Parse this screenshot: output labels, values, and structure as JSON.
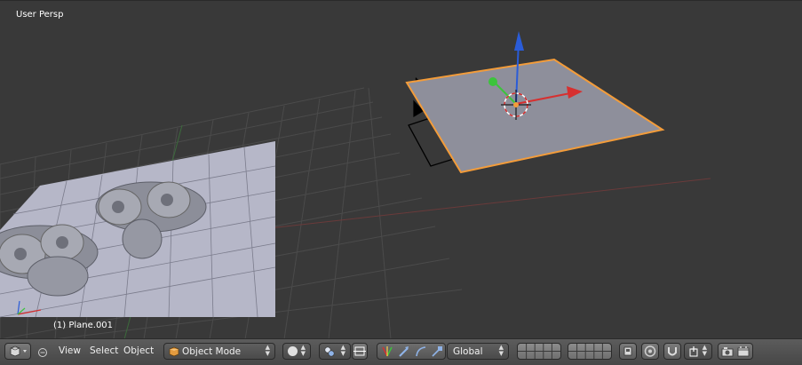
{
  "viewport": {
    "view_label": "User Persp",
    "object_label": "(1) Plane.001"
  },
  "header": {
    "menus": {
      "view": "View",
      "select": "Select",
      "object": "Object"
    },
    "mode": {
      "label": "Object Mode",
      "icon": "cube-icon"
    },
    "orientation": {
      "label": "Global"
    },
    "icons": [
      "view3d-editor-icon",
      "collapse-icon",
      "viewport-shading-icon",
      "pivot-point-icon",
      "snap-icon",
      "manipulator-icons",
      "layer-buttons",
      "lock-icon",
      "proportional-edit-icon",
      "magnet-icon",
      "render-icons"
    ]
  },
  "colors": {
    "viewport_bg": "#393939",
    "grid": "#4a4a4a",
    "selection_outline": "#f39c3a",
    "x_axis": "#d63030",
    "y_axis": "#3cc43c",
    "z_axis": "#2a5cd8"
  }
}
